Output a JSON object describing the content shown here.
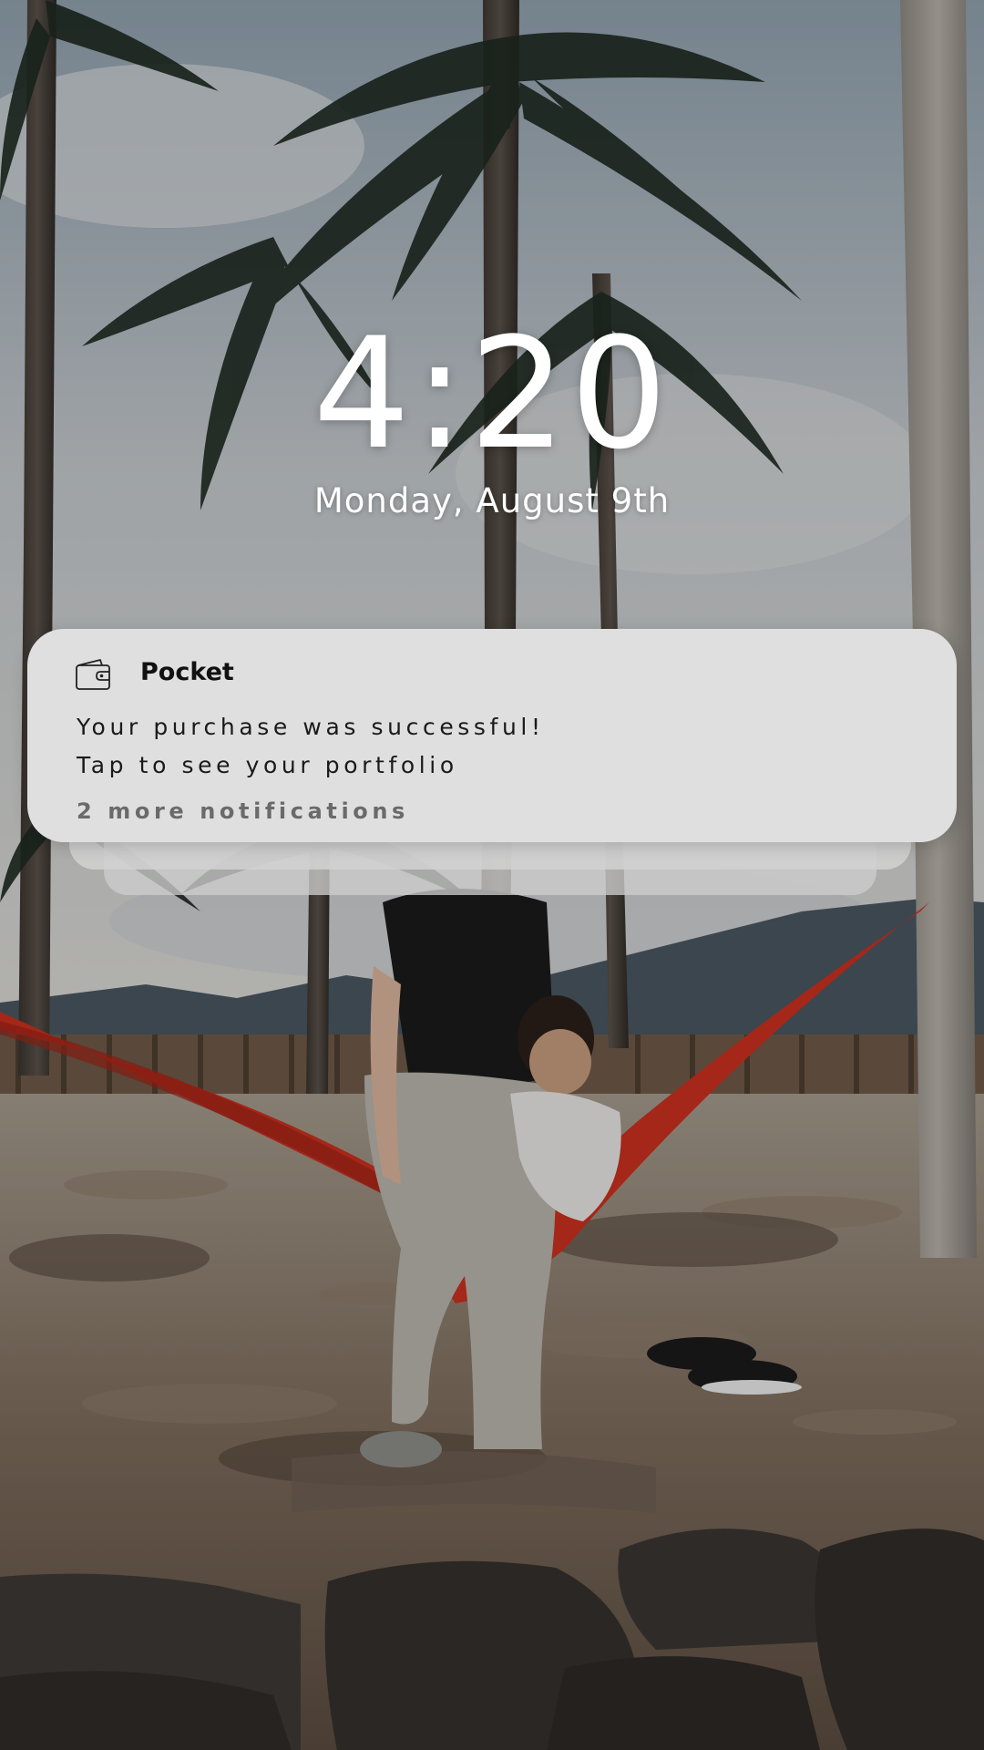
{
  "lock_screen": {
    "time": "4:20",
    "date": "Monday, August 9th"
  },
  "notification": {
    "app_icon": "wallet-icon",
    "app_name": "Pocket",
    "message_line_1": "Your purchase was successful!",
    "message_line_2": "Tap to see your portfolio",
    "more_label": "2 more notifications"
  },
  "wallpaper": {
    "sky_color": "#b9c0c6",
    "hammock_color": "#c8301f",
    "card_color": "#e0dfdf"
  }
}
